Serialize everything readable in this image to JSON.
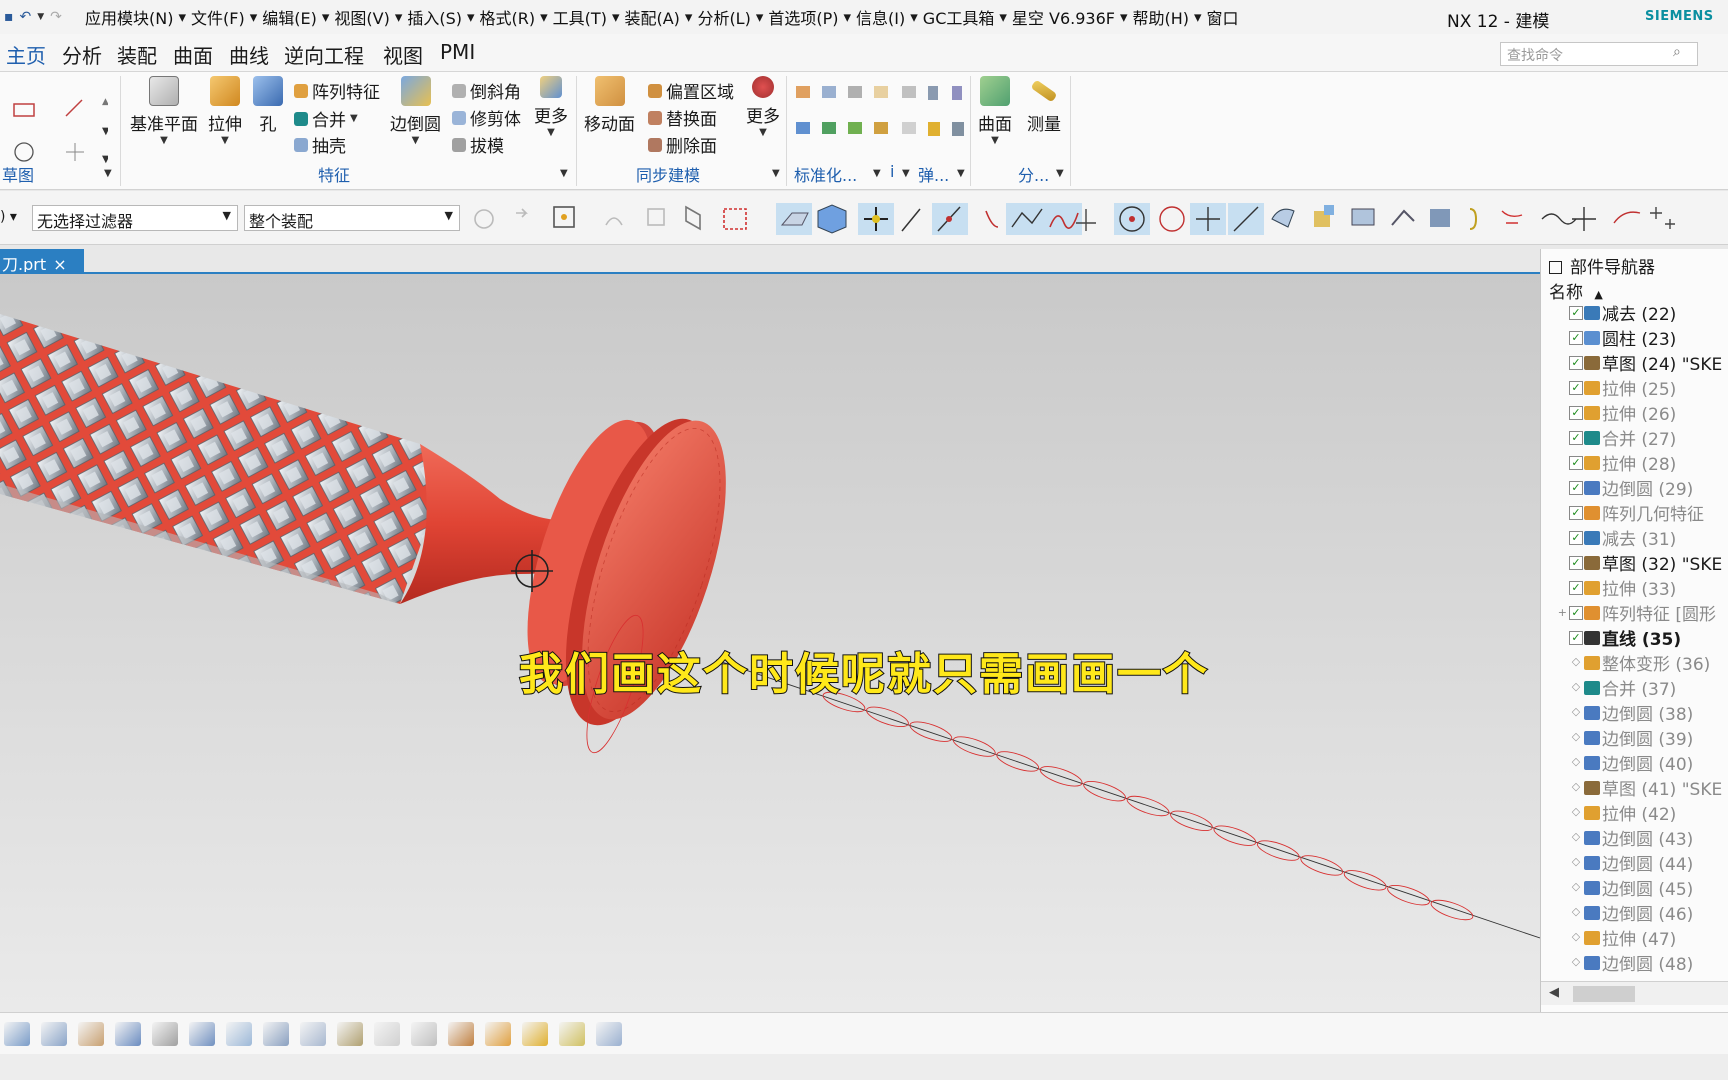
{
  "window": {
    "title": "NX 12 - 建模",
    "brand": "SIEMENS"
  },
  "menu": [
    "应用模块(N)",
    "文件(F)",
    "编辑(E)",
    "视图(V)",
    "插入(S)",
    "格式(R)",
    "工具(T)",
    "装配(A)",
    "分析(L)",
    "首选项(P)",
    "信息(I)",
    "GC工具箱",
    "星空 V6.936F",
    "帮助(H)",
    "窗口"
  ],
  "tabs": [
    "主页",
    "分析",
    "装配",
    "曲面",
    "曲线",
    "逆向工程",
    "视图",
    "PMI"
  ],
  "active_tab": "主页",
  "command_search": {
    "placeholder": "查找命令"
  },
  "ribbon": {
    "sketch_group": "草图",
    "feature_group": "特征",
    "sync_group": "同步建模",
    "std_group": "标准化...",
    "spring_group": "弹...",
    "analysis_group": "分...",
    "datum_plane": "基准平面",
    "extrude": "拉伸",
    "hole": "孔",
    "pattern_feature": "阵列特征",
    "unite": "合并",
    "shell": "抽壳",
    "edge_blend": "边倒圆",
    "chamfer": "倒斜角",
    "trim_body": "修剪体",
    "draft": "拔模",
    "more": "更多",
    "move_face": "移动面",
    "offset_region": "偏置区域",
    "replace_face": "替换面",
    "delete_face": "删除面",
    "more2": "更多",
    "surface": "曲面",
    "measure": "测量",
    "info_i": "i"
  },
  "selection": {
    "filter": "无选择过滤器",
    "scope": "整个装配"
  },
  "document_tab": {
    "label": "刀.prt",
    "close": "×"
  },
  "subtitle": "我们画这个时候呢就只需画画一个",
  "navigator": {
    "title": "部件导航器",
    "column": "名称",
    "rows": [
      {
        "name": "减去 (22)",
        "checked": true,
        "state": "normal",
        "icon": "#3a7ab8"
      },
      {
        "name": "圆柱 (23)",
        "checked": true,
        "state": "normal",
        "icon": "#5b8fd0"
      },
      {
        "name": "草图 (24) \"SKE",
        "checked": true,
        "state": "normal",
        "icon": "#8a6a3a"
      },
      {
        "name": "拉伸 (25)",
        "checked": true,
        "state": "dim",
        "icon": "#e0a030"
      },
      {
        "name": "拉伸 (26)",
        "checked": true,
        "state": "dim",
        "icon": "#e0a030"
      },
      {
        "name": "合并 (27)",
        "checked": true,
        "state": "dim",
        "icon": "#1e8a8a"
      },
      {
        "name": "拉伸 (28)",
        "checked": true,
        "state": "dim",
        "icon": "#e0a030"
      },
      {
        "name": "边倒圆 (29)",
        "checked": true,
        "state": "dim",
        "icon": "#4a7ac0"
      },
      {
        "name": "阵列几何特征",
        "checked": true,
        "state": "dim",
        "icon": "#e09030"
      },
      {
        "name": "减去 (31)",
        "checked": true,
        "state": "dim",
        "icon": "#3a7ab8"
      },
      {
        "name": "草图 (32) \"SKE",
        "checked": true,
        "state": "normal",
        "icon": "#8a6a3a"
      },
      {
        "name": "拉伸 (33)",
        "checked": true,
        "state": "dim",
        "icon": "#e0a030"
      },
      {
        "name": "阵列特征 [圆形",
        "checked": true,
        "state": "dim",
        "icon": "#e09030",
        "expand": "+"
      },
      {
        "name": "直线 (35)",
        "checked": true,
        "state": "bold",
        "icon": "#333333"
      },
      {
        "name": "整体变形 (36)",
        "checked": false,
        "state": "dim",
        "icon": "#e0a030"
      },
      {
        "name": "合并 (37)",
        "checked": false,
        "state": "dim",
        "icon": "#1e8a8a"
      },
      {
        "name": "边倒圆 (38)",
        "checked": false,
        "state": "dim",
        "icon": "#4a7ac0"
      },
      {
        "name": "边倒圆 (39)",
        "checked": false,
        "state": "dim",
        "icon": "#4a7ac0"
      },
      {
        "name": "边倒圆 (40)",
        "checked": false,
        "state": "dim",
        "icon": "#4a7ac0"
      },
      {
        "name": "草图 (41) \"SKE",
        "checked": false,
        "state": "dim",
        "icon": "#8a6a3a"
      },
      {
        "name": "拉伸 (42)",
        "checked": false,
        "state": "dim",
        "icon": "#e0a030"
      },
      {
        "name": "边倒圆 (43)",
        "checked": false,
        "state": "dim",
        "icon": "#4a7ac0"
      },
      {
        "name": "边倒圆 (44)",
        "checked": false,
        "state": "dim",
        "icon": "#4a7ac0"
      },
      {
        "name": "边倒圆 (45)",
        "checked": false,
        "state": "dim",
        "icon": "#4a7ac0"
      },
      {
        "name": "边倒圆 (46)",
        "checked": false,
        "state": "dim",
        "icon": "#4a7ac0"
      },
      {
        "name": "拉伸 (47)",
        "checked": false,
        "state": "dim",
        "icon": "#e0a030"
      },
      {
        "name": "边倒圆 (48)",
        "checked": false,
        "state": "dim",
        "icon": "#4a7ac0"
      }
    ]
  },
  "colors": {
    "accent": "#1f5fae",
    "model_red": "#e8483c",
    "subtitle_fill": "#ffe81a"
  }
}
